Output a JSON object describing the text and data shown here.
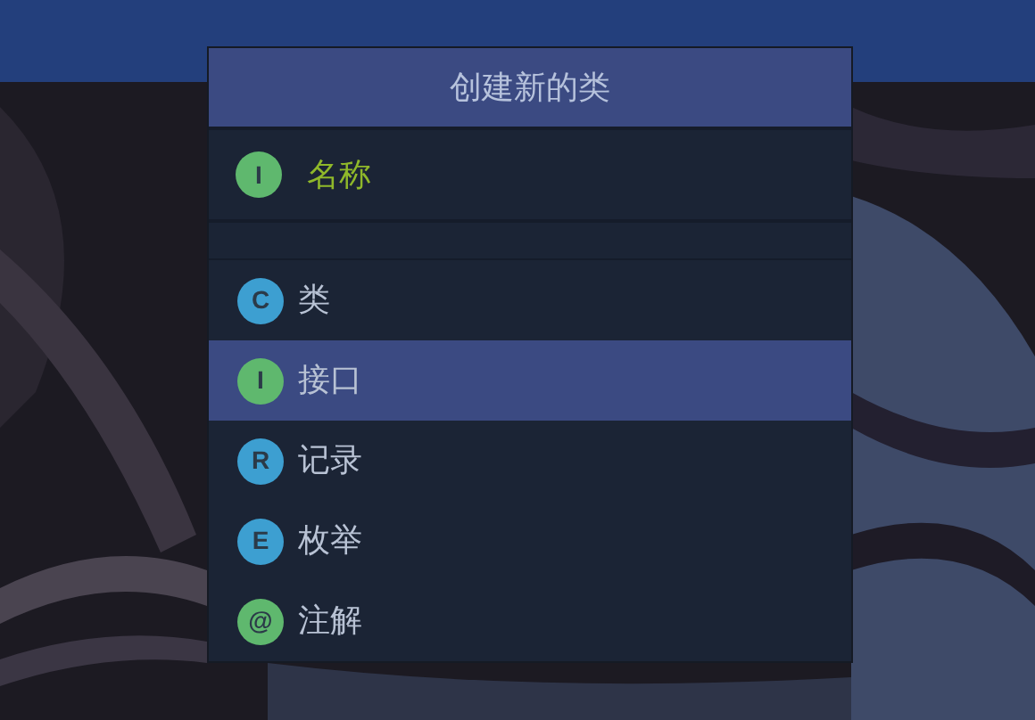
{
  "popup": {
    "title": "创建新的类",
    "name_field": {
      "placeholder": "名称",
      "badge": "I",
      "color": "#5fb86e"
    },
    "items": [
      {
        "badge": "C",
        "label": "类",
        "color": "#3d9fd1",
        "selected": false
      },
      {
        "badge": "I",
        "label": "接口",
        "color": "#5fb86e",
        "selected": true
      },
      {
        "badge": "R",
        "label": "记录",
        "color": "#3d9fd1",
        "selected": false
      },
      {
        "badge": "E",
        "label": "枚举",
        "color": "#3d9fd1",
        "selected": false
      },
      {
        "badge": "@",
        "label": "注解",
        "color": "#5fb86e",
        "selected": false
      }
    ]
  }
}
